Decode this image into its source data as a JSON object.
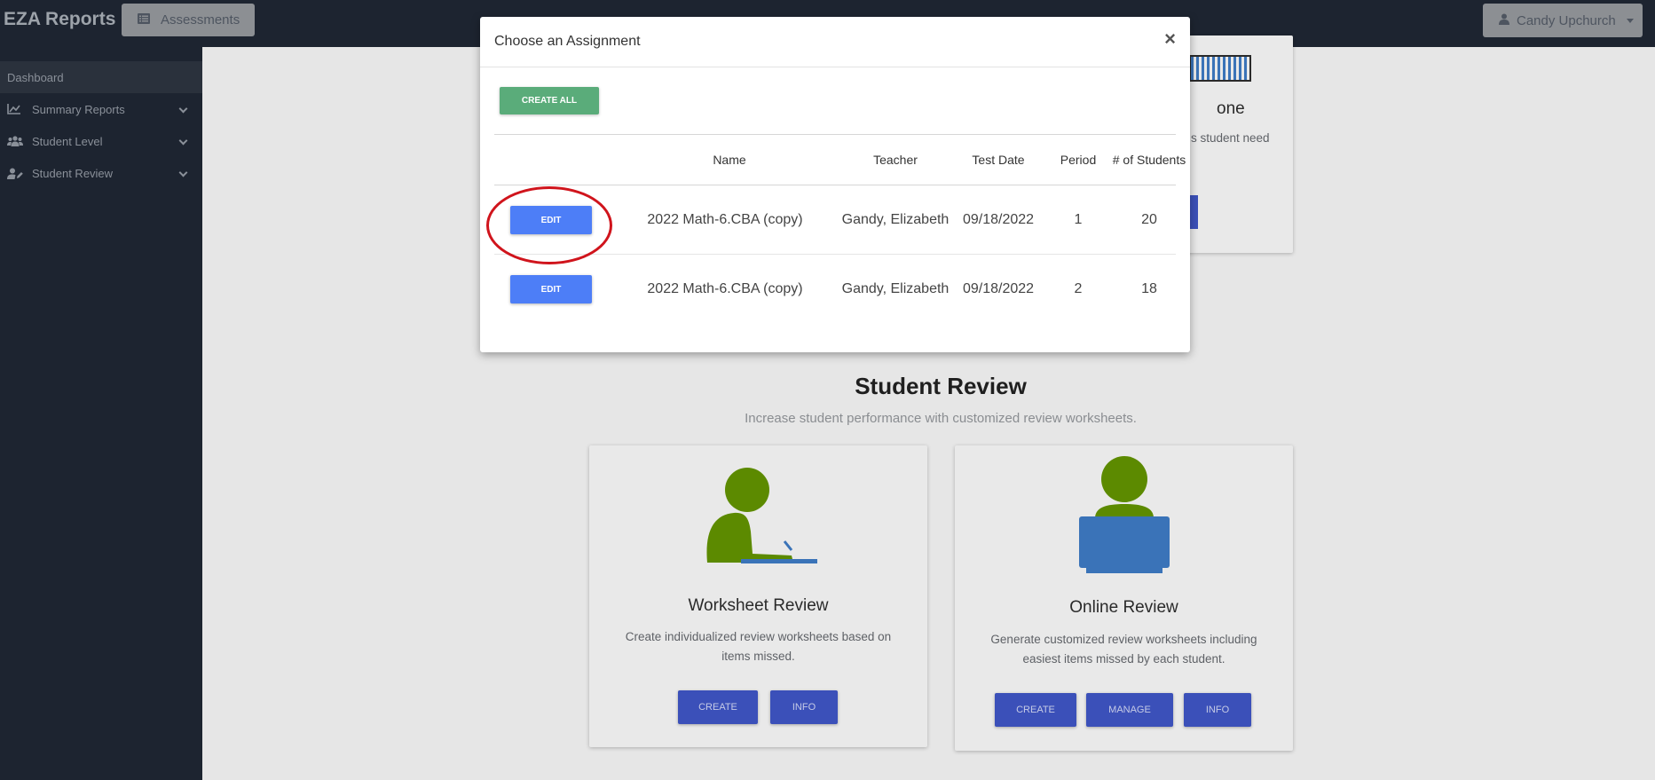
{
  "topbar": {
    "brand": "EZA Reports",
    "nav_assessments": "Assessments",
    "user_name": "Candy Upchurch"
  },
  "sidebar": {
    "items": [
      {
        "label": "Dashboard"
      },
      {
        "label": "Summary Reports"
      },
      {
        "label": "Student Level"
      },
      {
        "label": "Student Review"
      }
    ]
  },
  "background": {
    "partial_heading": "one",
    "partial_text": "s student need",
    "section_title": "Student Review",
    "section_subtitle": "Increase student performance with customized review worksheets.",
    "cards": [
      {
        "title": "Worksheet Review",
        "desc": "Create individualized review worksheets based on items missed.",
        "buttons": [
          "CREATE",
          "INFO"
        ]
      },
      {
        "title": "Online Review",
        "desc": "Generate customized review worksheets including easiest items missed by each student.",
        "buttons": [
          "CREATE",
          "MANAGE",
          "INFO"
        ]
      }
    ]
  },
  "modal": {
    "title": "Choose an Assignment",
    "close": "×",
    "create_all": "CREATE ALL",
    "columns": [
      "Name",
      "Teacher",
      "Test Date",
      "Period",
      "# of Students"
    ],
    "rows": [
      {
        "action": "EDIT",
        "name": "2022 Math-6.CBA (copy)",
        "teacher": "Gandy, Elizabeth",
        "test_date": "09/18/2022",
        "period": "1",
        "students": "20"
      },
      {
        "action": "EDIT",
        "name": "2022 Math-6.CBA (copy)",
        "teacher": "Gandy, Elizabeth",
        "test_date": "09/18/2022",
        "period": "2",
        "students": "18"
      }
    ]
  },
  "colors": {
    "dark_nav": "#1d2430",
    "edit_blue": "#4d7ef7",
    "create_all_green": "#5aac7a",
    "card_button_blue": "#3b50b9",
    "icon_green": "#5c8a00",
    "icon_blue": "#3a73b8",
    "highlight_red": "#d0141c"
  }
}
